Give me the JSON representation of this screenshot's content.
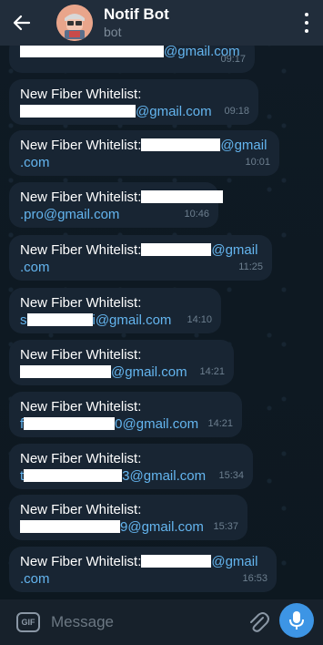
{
  "header": {
    "title": "Notif Bot",
    "subtitle": "bot"
  },
  "icons": {
    "back": "arrow-left-icon",
    "menu": "more-vertical-icon",
    "gif": "gif-icon",
    "attach": "paperclip-icon",
    "mic": "microphone-icon"
  },
  "colors": {
    "background": "#0e1621",
    "header": "#212d3b",
    "bubble": "#182533",
    "link": "#64b5ef",
    "accent": "#3d95e5"
  },
  "messages": [
    {
      "prefix": "",
      "suffix": "@gmail.com",
      "time": "09:17"
    },
    {
      "prefix": "New Fiber Whitelist:",
      "suffix": "@gmail.com",
      "time": "09:18"
    },
    {
      "prefix": "New Fiber Whitelist:",
      "suffix": "@gmail",
      "suffix2": ".com",
      "time": "10:01"
    },
    {
      "prefix": "New Fiber Whitelist:",
      "suffix": ".pro@gmail.com",
      "time": "10:46"
    },
    {
      "prefix": "New Fiber Whitelist:",
      "suffix": "@gmail",
      "suffix2": ".com",
      "time": "11:25"
    },
    {
      "prefix": "New Fiber Whitelist:",
      "line2a": "s",
      "suffix": "i@gmail.com",
      "time": "14:10"
    },
    {
      "prefix": "New Fiber Whitelist:",
      "suffix": "@gmail.com",
      "time": "14:21"
    },
    {
      "prefix": "New Fiber Whitelist:",
      "line2a": "f",
      "suffix": "0@gmail.com",
      "time": "14:21"
    },
    {
      "prefix": "New Fiber Whitelist:",
      "line2a": "t",
      "suffix": "3@gmail.com",
      "time": "15:34"
    },
    {
      "prefix": "New Fiber Whitelist:",
      "suffix": "9@gmail.com",
      "time": "15:37"
    },
    {
      "prefix": "New Fiber Whitelist:",
      "suffix": "@gmail",
      "suffix2": ".com",
      "time": "16:53"
    }
  ],
  "input": {
    "placeholder": "Message",
    "gif_label": "GIF"
  }
}
